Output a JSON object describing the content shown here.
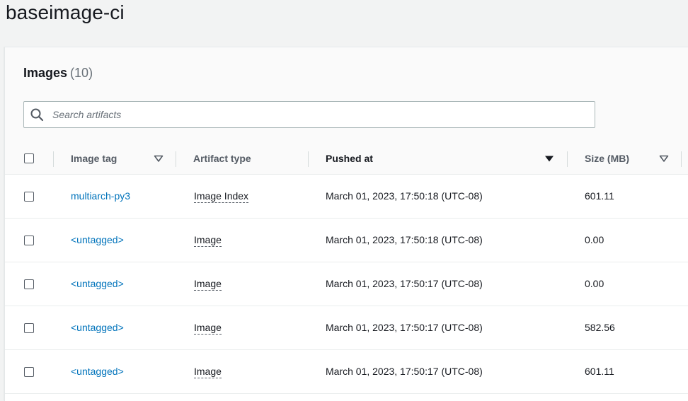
{
  "page": {
    "title": "baseimage-ci"
  },
  "images_panel": {
    "heading": "Images",
    "count": "(10)",
    "search": {
      "placeholder": "Search artifacts",
      "value": ""
    }
  },
  "table": {
    "columns": [
      {
        "label": "Image tag",
        "sort": "sortable"
      },
      {
        "label": "Artifact type",
        "sort": "none"
      },
      {
        "label": "Pushed at",
        "sort": "descending"
      },
      {
        "label": "Size (MB)",
        "sort": "sortable"
      }
    ],
    "rows": [
      {
        "tag": "multiarch-py3",
        "type": "Image Index",
        "pushed": "March 01, 2023, 17:50:18 (UTC-08)",
        "size": "601.11"
      },
      {
        "tag": "<untagged>",
        "type": "Image",
        "pushed": "March 01, 2023, 17:50:18 (UTC-08)",
        "size": "0.00"
      },
      {
        "tag": "<untagged>",
        "type": "Image",
        "pushed": "March 01, 2023, 17:50:17 (UTC-08)",
        "size": "0.00"
      },
      {
        "tag": "<untagged>",
        "type": "Image",
        "pushed": "March 01, 2023, 17:50:17 (UTC-08)",
        "size": "582.56"
      },
      {
        "tag": "<untagged>",
        "type": "Image",
        "pushed": "March 01, 2023, 17:50:17 (UTC-08)",
        "size": "601.11"
      }
    ]
  },
  "colors": {
    "link": "#0073bb",
    "text": "#16191f",
    "header_text": "#545b64",
    "background": "#f2f3f3"
  },
  "icons": {
    "search": "search-icon",
    "sort_sortable": "caret-down-outline-icon",
    "sort_descending": "caret-down-filled-icon"
  }
}
